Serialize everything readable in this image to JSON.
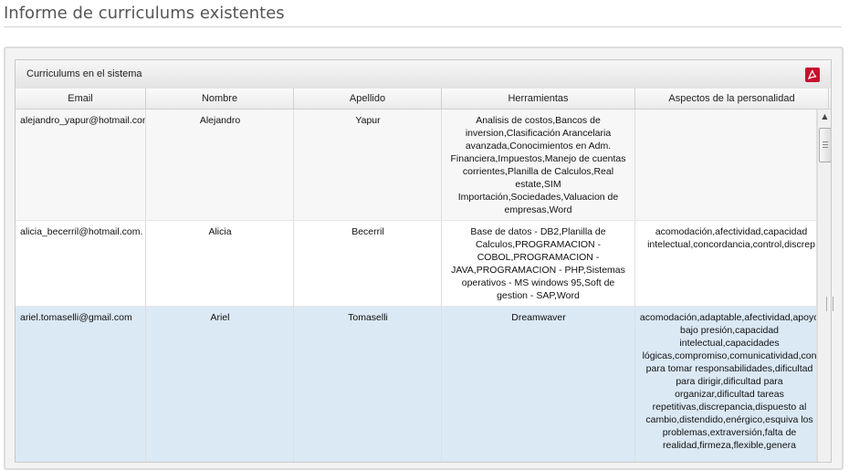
{
  "page": {
    "title": "Informe de curriculums existentes"
  },
  "grid": {
    "caption": "Curriculums en el sistema",
    "export_icon": "pdf-icon",
    "columns": [
      "Email",
      "Nombre",
      "Apellido",
      "Herramientas",
      "Aspectos de la personalidad"
    ],
    "rows": [
      {
        "email": "alejandro_yapur@hotmail.com",
        "nombre": "Alejandro",
        "apellido": "Yapur",
        "herramientas": "Analisis de costos,Bancos de inversion,Clasificación Arancelaria avanzada,Conocimientos en Adm. Financiera,Impuestos,Manejo de cuentas corrientes,Planilla de Calculos,Real estate,SIM Importación,Sociedades,Valuacion de empresas,Word",
        "aspectos": ""
      },
      {
        "email": "alicia_becerril@hotmail.com.",
        "nombre": "Alicia",
        "apellido": "Becerril",
        "herramientas": "Base de datos - DB2,Planilla de Calculos,PROGRAMACION - COBOL,PROGRAMACION - JAVA,PROGRAMACION - PHP,Sistemas operativos - MS windows 95,Soft de gestion - SAP,Word",
        "aspectos": "acomodación,afectividad,capacidad intelectual,concordancia,control,discrep"
      },
      {
        "email": "ariel.tomaselli@gmail.com",
        "nombre": "Ariel",
        "apellido": "Tomaselli",
        "herramientas": "Dreamwaver",
        "aspectos": "acomodación,adaptable,afectividad,apoyo bajo presión,capacidad intelectual,capacidades lógicas,compromiso,comunicatividad,con para tomar responsabilidades,dificultad para dirigir,dificultad para organizar,dificultad tareas repetitivas,discrepancia,dispuesto al cambio,distendido,enérgico,esquiva los problemas,extraversión,falta de realidad,firmeza,flexible,genera"
      }
    ]
  }
}
